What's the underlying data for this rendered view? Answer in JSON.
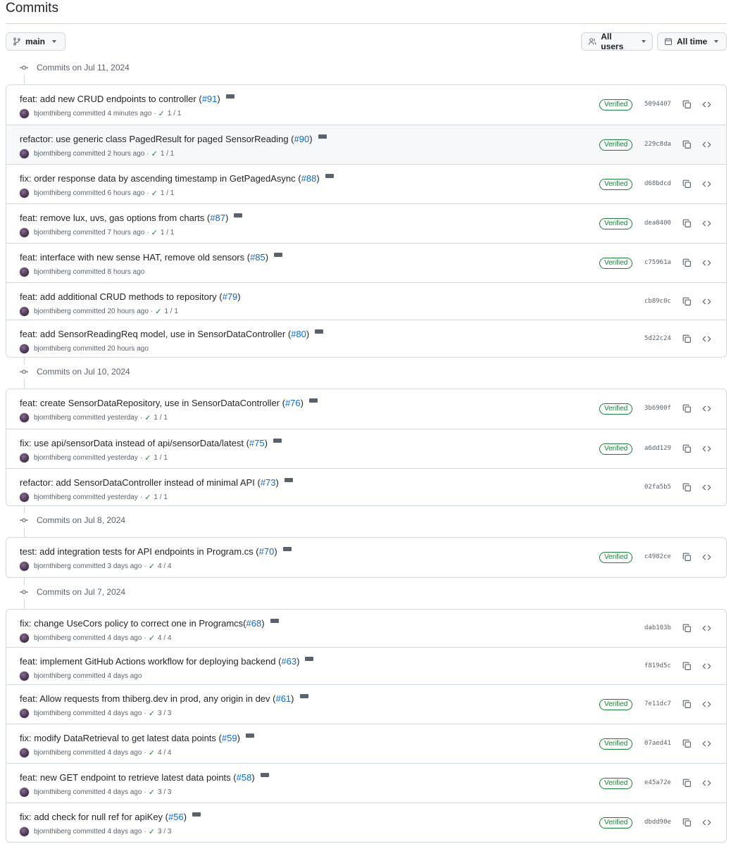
{
  "page": {
    "title": "Commits"
  },
  "toolbar": {
    "branch": "main",
    "users": "All users",
    "time": "All time"
  },
  "colors": {
    "verified": "#1a7f37",
    "link": "#0969da",
    "muted": "#59636e",
    "border": "#d1d9e0"
  },
  "groups": [
    {
      "label": "Commits on Jul 11, 2024",
      "commits": [
        {
          "prefix": "feat: add new CRUD endpoints to controller (",
          "pr": "#91",
          "suffix": ")",
          "author": "bjornthiberg",
          "time": "committed 4 minutes ago",
          "checks": "1 / 1",
          "verified": "Verified",
          "sha": "5094407",
          "more": true
        },
        {
          "prefix": "refactor: use generic class PagedResult for paged SensorReading (",
          "pr": "#90",
          "suffix": ")",
          "author": "bjornthiberg",
          "time": "committed 2 hours ago",
          "checks": "1 / 1",
          "verified": "Verified",
          "sha": "229c8da",
          "more": true,
          "hover": true
        },
        {
          "prefix": "fix: order response data by ascending timestamp in GetPagedAsync (",
          "pr": "#88",
          "suffix": ")",
          "author": "bjornthiberg",
          "time": "committed 6 hours ago",
          "checks": "1 / 1",
          "verified": "Verified",
          "sha": "d68bdcd",
          "more": true
        },
        {
          "prefix": "feat: remove lux, uvs, gas options from charts (",
          "pr": "#87",
          "suffix": ")",
          "author": "bjornthiberg",
          "time": "committed 7 hours ago",
          "checks": "1 / 1",
          "verified": "Verified",
          "sha": "dea8400",
          "more": true
        },
        {
          "prefix": "feat: interface with new sense HAT, remove old sensors (",
          "pr": "#85",
          "suffix": ")",
          "author": "bjornthiberg",
          "time": "committed 8 hours ago",
          "checks": "",
          "verified": "Verified",
          "sha": "c75961a",
          "more": true
        },
        {
          "prefix": "feat: add additional CRUD methods to repository (",
          "pr": "#79",
          "suffix": ")",
          "author": "bjornthiberg",
          "time": "committed 20 hours ago",
          "checks": "1 / 1",
          "verified": "",
          "sha": "cb89c0c",
          "more": false
        },
        {
          "prefix": "feat: add SensorReadingReq model, use in SensorDataController (",
          "pr": "#80",
          "suffix": ")",
          "author": "bjornthiberg",
          "time": "committed 20 hours ago",
          "checks": "",
          "verified": "",
          "sha": "5d22c24",
          "more": true
        }
      ]
    },
    {
      "label": "Commits on Jul 10, 2024",
      "commits": [
        {
          "prefix": "feat: create SensorDataRepository, use in SensorDataController (",
          "pr": "#76",
          "suffix": ")",
          "author": "bjornthiberg",
          "time": "committed yesterday",
          "checks": "1 / 1",
          "verified": "Verified",
          "sha": "3b6900f",
          "more": true
        },
        {
          "prefix": "fix: use api/sensorData instead of api/sensorData/latest (",
          "pr": "#75",
          "suffix": ")",
          "author": "bjornthiberg",
          "time": "committed yesterday",
          "checks": "1 / 1",
          "verified": "Verified",
          "sha": "a6dd129",
          "more": true
        },
        {
          "prefix": "refactor: add SensorDataController instead of minimal API (",
          "pr": "#73",
          "suffix": ")",
          "author": "bjornthiberg",
          "time": "committed yesterday",
          "checks": "1 / 1",
          "verified": "",
          "sha": "02fa5b5",
          "more": true
        }
      ]
    },
    {
      "label": "Commits on Jul 8, 2024",
      "commits": [
        {
          "prefix": "test: add integration tests for API endpoints in Program.cs (",
          "pr": "#70",
          "suffix": ")",
          "author": "bjornthiberg",
          "time": "committed 3 days ago",
          "checks": "4 / 4",
          "verified": "Verified",
          "sha": "c4982ce",
          "more": true
        }
      ]
    },
    {
      "label": "Commits on Jul 7, 2024",
      "commits": [
        {
          "prefix": "fix: change UseCors policy to correct one in Programcs(",
          "pr": "#68",
          "suffix": ")",
          "author": "bjornthiberg",
          "time": "committed 4 days ago",
          "checks": "4 / 4",
          "verified": "",
          "sha": "dab103b",
          "more": true
        },
        {
          "prefix": "feat: implement GitHub Actions workflow for deploying backend (",
          "pr": "#63",
          "suffix": ")",
          "author": "bjornthiberg",
          "time": "committed 4 days ago",
          "checks": "",
          "verified": "",
          "sha": "f819d5c",
          "more": true
        },
        {
          "prefix": "feat: Allow requests from thiberg.dev in prod, any origin in dev (",
          "pr": "#61",
          "suffix": ")",
          "author": "bjornthiberg",
          "time": "committed 4 days ago",
          "checks": "3 / 3",
          "verified": "Verified",
          "sha": "7e11dc7",
          "more": true
        },
        {
          "prefix": "fix: modify DataRetrieval to get latest data points (",
          "pr": "#59",
          "suffix": ")",
          "author": "bjornthiberg",
          "time": "committed 4 days ago",
          "checks": "4 / 4",
          "verified": "Verified",
          "sha": "07aed41",
          "more": true
        },
        {
          "prefix": "feat: new GET endpoint to retrieve latest data points (",
          "pr": "#58",
          "suffix": ")",
          "author": "bjornthiberg",
          "time": "committed 4 days ago",
          "checks": "3 / 3",
          "verified": "Verified",
          "sha": "e45a72e",
          "more": true
        },
        {
          "prefix": "fix: add check for null ref for apiKey (",
          "pr": "#56",
          "suffix": ")",
          "author": "bjornthiberg",
          "time": "committed 4 days ago",
          "checks": "3 / 3",
          "verified": "Verified",
          "sha": "dbdd90e",
          "more": true
        }
      ]
    }
  ]
}
